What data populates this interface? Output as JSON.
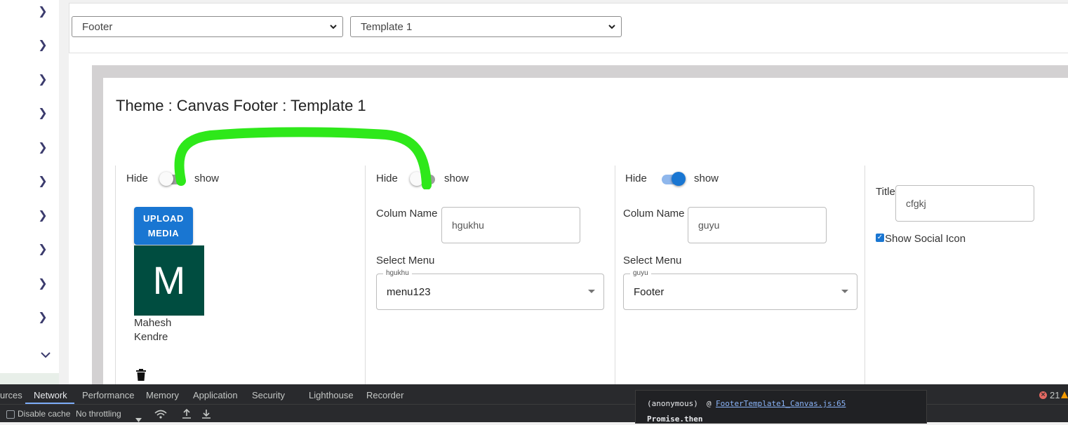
{
  "top_selects": {
    "section": {
      "value": "Footer"
    },
    "template": {
      "value": "Template 1"
    }
  },
  "page": {
    "title": "Theme : Canvas Footer : Template 1"
  },
  "columns": [
    {
      "toggle": {
        "hide_label": "Hide",
        "show_label": "show",
        "on": false
      },
      "upload_button": "UPLOAD MEDIA",
      "avatar_letter": "M",
      "user_name": "Mahesh Kendre"
    },
    {
      "toggle": {
        "hide_label": "Hide",
        "show_label": "show",
        "on": false
      },
      "column_name_label": "Colum Name",
      "column_name_value": "hgukhu",
      "select_menu_label": "Select Menu",
      "select_menu_legend": "hgukhu",
      "select_menu_value": "menu123"
    },
    {
      "toggle": {
        "hide_label": "Hide",
        "show_label": "show",
        "on": true
      },
      "column_name_label": "Colum Name",
      "column_name_value": "guyu",
      "select_menu_label": "Select Menu",
      "select_menu_legend": "guyu",
      "select_menu_value": "Footer"
    },
    {
      "title_label": "Title",
      "title_value": "cfgkj",
      "show_social_label": "Show Social Icon",
      "show_social_checked": true
    }
  ],
  "devtools": {
    "tabs": [
      "urces",
      "Network",
      "Performance",
      "Memory",
      "Application",
      "Security",
      "Lighthouse",
      "Recorder"
    ],
    "active_tab": "Network",
    "disable_cache_label": "Disable cache",
    "throttling_value": "No throttling",
    "popup_line1_prefix": "(anonymous)",
    "popup_line1_at": "@",
    "popup_line1_link": "FooterTemplate1_Canvas.js:65",
    "popup_line2": "Promise.then",
    "error_count": "21"
  },
  "colors": {
    "primary": "#1976d2",
    "avatar_bg": "#004d40",
    "annotation": "#2ee81a",
    "devtools_bg": "#292a2d"
  }
}
